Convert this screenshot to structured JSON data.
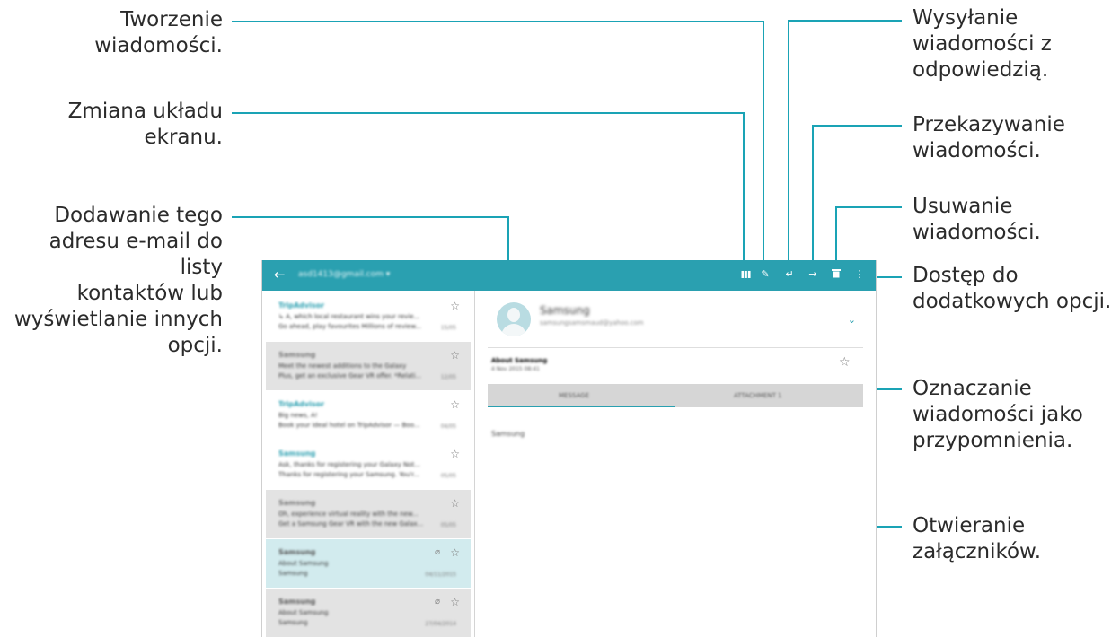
{
  "callouts": {
    "compose": "Tworzenie\nwiadomości.",
    "layout": "Zmiana układu\nekranu.",
    "contact": "Dodawanie tego\nadresu e-mail do listy\nkontaktów lub\nwyświetlanie innych\nopcji.",
    "reply": "Wysyłanie\nwiadomości z\nodpowiedzią.",
    "forward": "Przekazywanie\nwiadomości.",
    "delete": "Usuwanie\nwiadomości.",
    "more": "Dostęp do\ndodatkowych opcji.",
    "star": "Oznaczanie\nwiadomości jako\nprzypomnienia.",
    "attachments": "Otwieranie\nzałączników."
  },
  "appbar": {
    "back_icon": "←",
    "account": "asd1413@gmail.com ▾",
    "toolbar_icons": [
      "layout-icon",
      "compose-icon",
      "reply-icon",
      "forward-icon",
      "delete-icon",
      "more-icon"
    ],
    "toolbar_glyphs": [
      "❚❚❚",
      "✎",
      "↵",
      "→",
      "🗑",
      "⋮"
    ]
  },
  "email_list": [
    {
      "sender": "TripAdvisor",
      "line1": "↳ A, which local restaurant wins your revie...",
      "line2": "Go ahead, play favourites Millions of review...",
      "date": "15/05",
      "color": "#2a9fb0",
      "bg": "#ffffff",
      "attachment": false
    },
    {
      "sender": "Samsung",
      "line1": "Meet the newest additions to the Galaxy",
      "line2": "Plus, get an exclusive Gear VR offer. *Relati...",
      "date": "12/05",
      "color": "#777777",
      "bg": "#e3e3e3",
      "attachment": false
    },
    {
      "sender": "TripAdvisor",
      "line1": "Big news, A!",
      "line2": "Book your ideal hotel on TripAdvisor — Boo...",
      "date": "04/05",
      "color": "#2a9fb0",
      "bg": "#ffffff",
      "attachment": false
    },
    {
      "sender": "Samsung",
      "line1": "Ask, thanks for registering your Galaxy Not...",
      "line2": "Thanks for registering your Samsung. You'r...",
      "date": "05/05",
      "color": "#2a9fb0",
      "bg": "#ffffff",
      "attachment": false
    },
    {
      "sender": "Samsung",
      "line1": "Oh, experience virtual reality with the new...",
      "line2": "Get a Samsung Gear VR with the new Galax...",
      "date": "05/05",
      "color": "#777777",
      "bg": "#e3e3e3",
      "attachment": false
    },
    {
      "sender": "Samsung",
      "line1": "About Samsung",
      "line2": "Samsung",
      "date": "04/11/2015",
      "color": "#555555",
      "bg": "#d2ebee",
      "attachment": true
    },
    {
      "sender": "Samsung",
      "line1": "About Samsung",
      "line2": "Samsung",
      "date": "27/04/2014",
      "color": "#555555",
      "bg": "#e3e3e3",
      "attachment": true
    }
  ],
  "detail": {
    "sender_name": "Samsung",
    "sender_email": "samsungsamsmaud@yahoo.com",
    "chevron": "⌄",
    "subject": "About Samsung",
    "timestamp": "4 Nov 2015 08:41",
    "star_icon": "☆",
    "tabs": [
      "MESSAGE",
      "ATTACHMENT 1"
    ],
    "body": "Samsung"
  },
  "icons": {
    "star": "☆",
    "attachment": "⌀"
  },
  "colors": {
    "accent": "#2aa0b0",
    "leader": "#1aa3b5"
  }
}
